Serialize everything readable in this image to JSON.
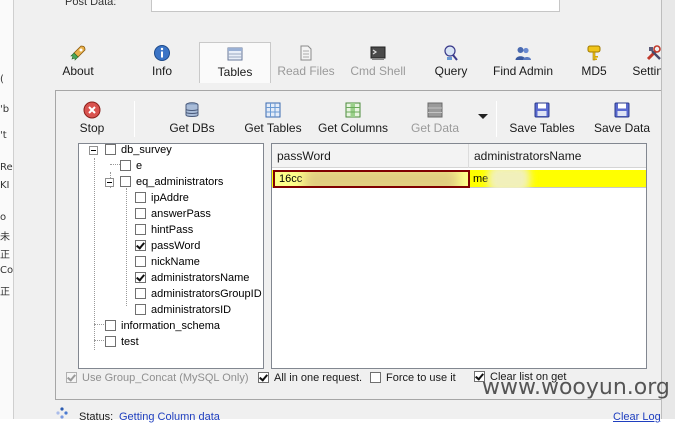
{
  "background": {
    "left_strip_chars": [
      "(",
      "'b",
      "'t",
      "Re",
      "KI",
      "o",
      "未",
      "正",
      "Co",
      "正"
    ]
  },
  "post_data": {
    "label": "Post Data:",
    "value": ""
  },
  "tabs": [
    {
      "label": "About",
      "icon": "rocket-icon",
      "state": "normal"
    },
    {
      "label": "Info",
      "icon": "info-icon",
      "state": "normal"
    },
    {
      "label": "Tables",
      "icon": "tables-icon",
      "state": "active"
    },
    {
      "label": "Read Files",
      "icon": "document-icon",
      "state": "disabled"
    },
    {
      "label": "Cmd Shell",
      "icon": "terminal-icon",
      "state": "disabled"
    },
    {
      "label": "Query",
      "icon": "query-icon",
      "state": "normal"
    },
    {
      "label": "Find Admin",
      "icon": "users-icon",
      "state": "normal"
    },
    {
      "label": "MD5",
      "icon": "key-icon",
      "state": "normal"
    },
    {
      "label": "Settings",
      "icon": "tools-icon",
      "state": "normal"
    }
  ],
  "toolbar": {
    "stop": "Stop",
    "get_dbs": "Get DBs",
    "get_tables": "Get Tables",
    "get_columns": "Get Columns",
    "get_data": "Get Data",
    "save_tables": "Save Tables",
    "save_data": "Save Data"
  },
  "tree": {
    "nodes": [
      {
        "label": "db_survey",
        "level": 0,
        "expanded": true,
        "checked": false
      },
      {
        "label": "e",
        "level": 1,
        "checked": false
      },
      {
        "label": "eq_administrators",
        "level": 1,
        "expanded": true,
        "checked": false
      },
      {
        "label": "ipAddre",
        "level": 2,
        "checked": false
      },
      {
        "label": "answerPass",
        "level": 2,
        "checked": false
      },
      {
        "label": "hintPass",
        "level": 2,
        "checked": false
      },
      {
        "label": "passWord",
        "level": 2,
        "checked": true
      },
      {
        "label": "nickName",
        "level": 2,
        "checked": false
      },
      {
        "label": "administratorsName",
        "level": 2,
        "checked": true
      },
      {
        "label": "administratorsGroupID",
        "level": 2,
        "checked": false
      },
      {
        "label": "administratorsID",
        "level": 2,
        "checked": false
      },
      {
        "label": "information_schema",
        "level": 0,
        "checked": false
      },
      {
        "label": "test",
        "level": 0,
        "checked": false
      }
    ]
  },
  "grid": {
    "columns": [
      "passWord",
      "administratorsName"
    ],
    "rows": [
      [
        "16cc",
        "me"
      ]
    ],
    "highlight_color": "#ffff00"
  },
  "options": {
    "use_group_concat": {
      "label": "Use Group_Concat (MySQL Only)",
      "checked": true,
      "enabled": false
    },
    "all_in_one": {
      "label": "All in one request.",
      "checked": true
    },
    "force_use": {
      "label": "Force to use it",
      "checked": false
    },
    "clear_list": {
      "label": "Clear list on get",
      "checked": true
    }
  },
  "status": {
    "label": "Status:",
    "value": "Getting Column data",
    "clear_log": "Clear Log"
  },
  "watermark": "www.wooyun.org"
}
